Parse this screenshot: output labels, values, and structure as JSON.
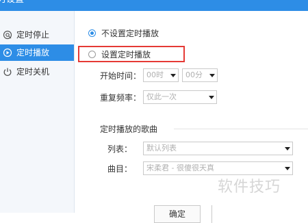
{
  "window": {
    "title": "时设置"
  },
  "sidebar": {
    "items": [
      {
        "label": "定时停止",
        "icon": "timer-stop-icon",
        "active": false
      },
      {
        "label": "定时播放",
        "icon": "timer-play-icon",
        "active": true
      },
      {
        "label": "定时关机",
        "icon": "power-icon",
        "active": false
      }
    ]
  },
  "main": {
    "options": {
      "no_schedule": "不设置定时播放",
      "set_schedule": "设置定时播放"
    },
    "start_time": {
      "label": "开始时间：",
      "hour": "00时",
      "minute": "00分"
    },
    "repeat": {
      "label": "重复频率：",
      "value": "仅此一次"
    },
    "songs_section": {
      "title": "定时播放的歌曲",
      "list_label": "列表：",
      "list_value": "默认列表",
      "song_label": "曲目：",
      "song_value": "宋柔君 - 很傻很天真"
    },
    "ok_button": "确定"
  },
  "watermark": "软件技巧",
  "colors": {
    "accent": "#2d8de6",
    "highlight_border": "#e53935"
  }
}
